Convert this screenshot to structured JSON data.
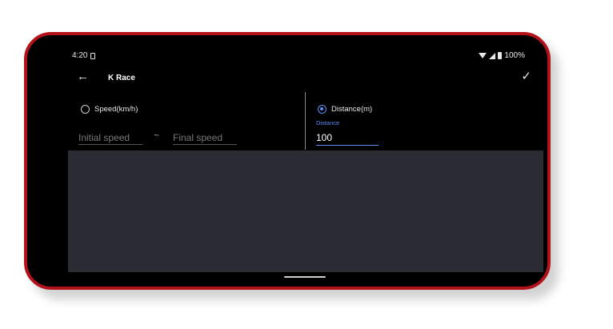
{
  "status_bar": {
    "time": "4:20",
    "battery": "100%"
  },
  "toolbar": {
    "title": "K Race"
  },
  "speed_option": {
    "label": "Speed(km/h)",
    "selected": false,
    "initial_placeholder": "Initial speed",
    "separator": "~",
    "final_placeholder": "Final speed"
  },
  "distance_option": {
    "label": "Distance(m)",
    "selected": true,
    "field_caption": "Distance",
    "field_value": "100"
  },
  "colors": {
    "frame": "#b3121b",
    "accent": "#5b8df5",
    "panel": "#2b2c33"
  }
}
